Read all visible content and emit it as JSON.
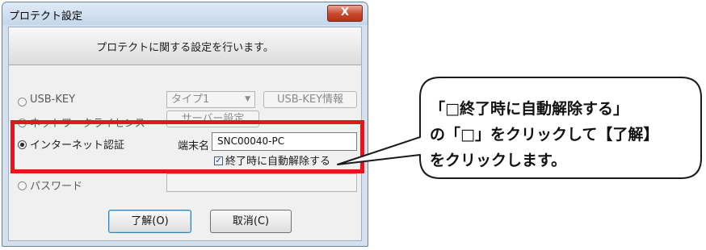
{
  "dialog": {
    "title": "プロテクト設定",
    "close_glyph": "X",
    "header": "プロテクトに関する設定を行います。",
    "options": {
      "usb_key": "USB-KEY",
      "network_license": "ネットワークライセンス",
      "internet_auth": "インターネット認証",
      "password": "パスワード"
    },
    "usb": {
      "type_value": "タイプ1",
      "info_button": "USB-KEY情報"
    },
    "network": {
      "server_button": "サーバー設定"
    },
    "internet": {
      "terminal_label": "端末名",
      "terminal_value": "SNC00040-PC",
      "auto_release_label": "終了時に自動解除する",
      "auto_release_checked": true
    },
    "buttons": {
      "ok": "了解(O)",
      "cancel": "取消(C)"
    },
    "selected_option": "internet_auth"
  },
  "callout": {
    "lines": [
      "「□終了時に自動解除する」",
      "の「□」をクリックして【了解】",
      "をクリックします。"
    ]
  },
  "colors": {
    "highlight": "#e8141b",
    "close_button": "#c8462c",
    "title_bar": "#c4d6ea"
  }
}
